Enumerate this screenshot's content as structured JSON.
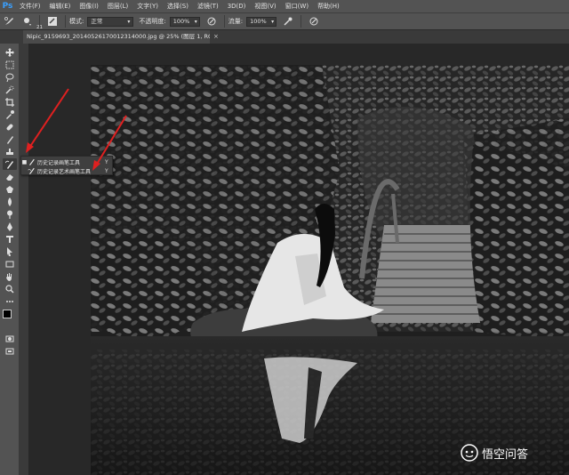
{
  "app": {
    "logo": "Ps"
  },
  "menu": [
    "文件(F)",
    "编辑(E)",
    "图像(I)",
    "图层(L)",
    "文字(Y)",
    "选择(S)",
    "滤镜(T)",
    "3D(D)",
    "视图(V)",
    "窗口(W)",
    "帮助(H)"
  ],
  "options": {
    "brush_size": "21",
    "mode_label": "模式:",
    "mode_value": "正常",
    "opacity_label": "不透明度:",
    "opacity_value": "100%",
    "flow_label": "流量:",
    "flow_value": "100%"
  },
  "document": {
    "tab_title": "Nipic_9159693_20140526170012314000.jpg @ 25% (图层 1, RGB/8*) *",
    "close": "×"
  },
  "flyout": {
    "items": [
      {
        "label": "历史记录画笔工具",
        "shortcut": "Y",
        "selected": true,
        "bullet": "■"
      },
      {
        "label": "历史记录艺术画笔工具",
        "shortcut": "Y",
        "selected": false,
        "bullet": ""
      }
    ]
  },
  "watermark": {
    "text": "悟空问答"
  },
  "colors": {
    "annotation_arrow": "#e02020",
    "ps_blue": "#3aa0ff"
  }
}
